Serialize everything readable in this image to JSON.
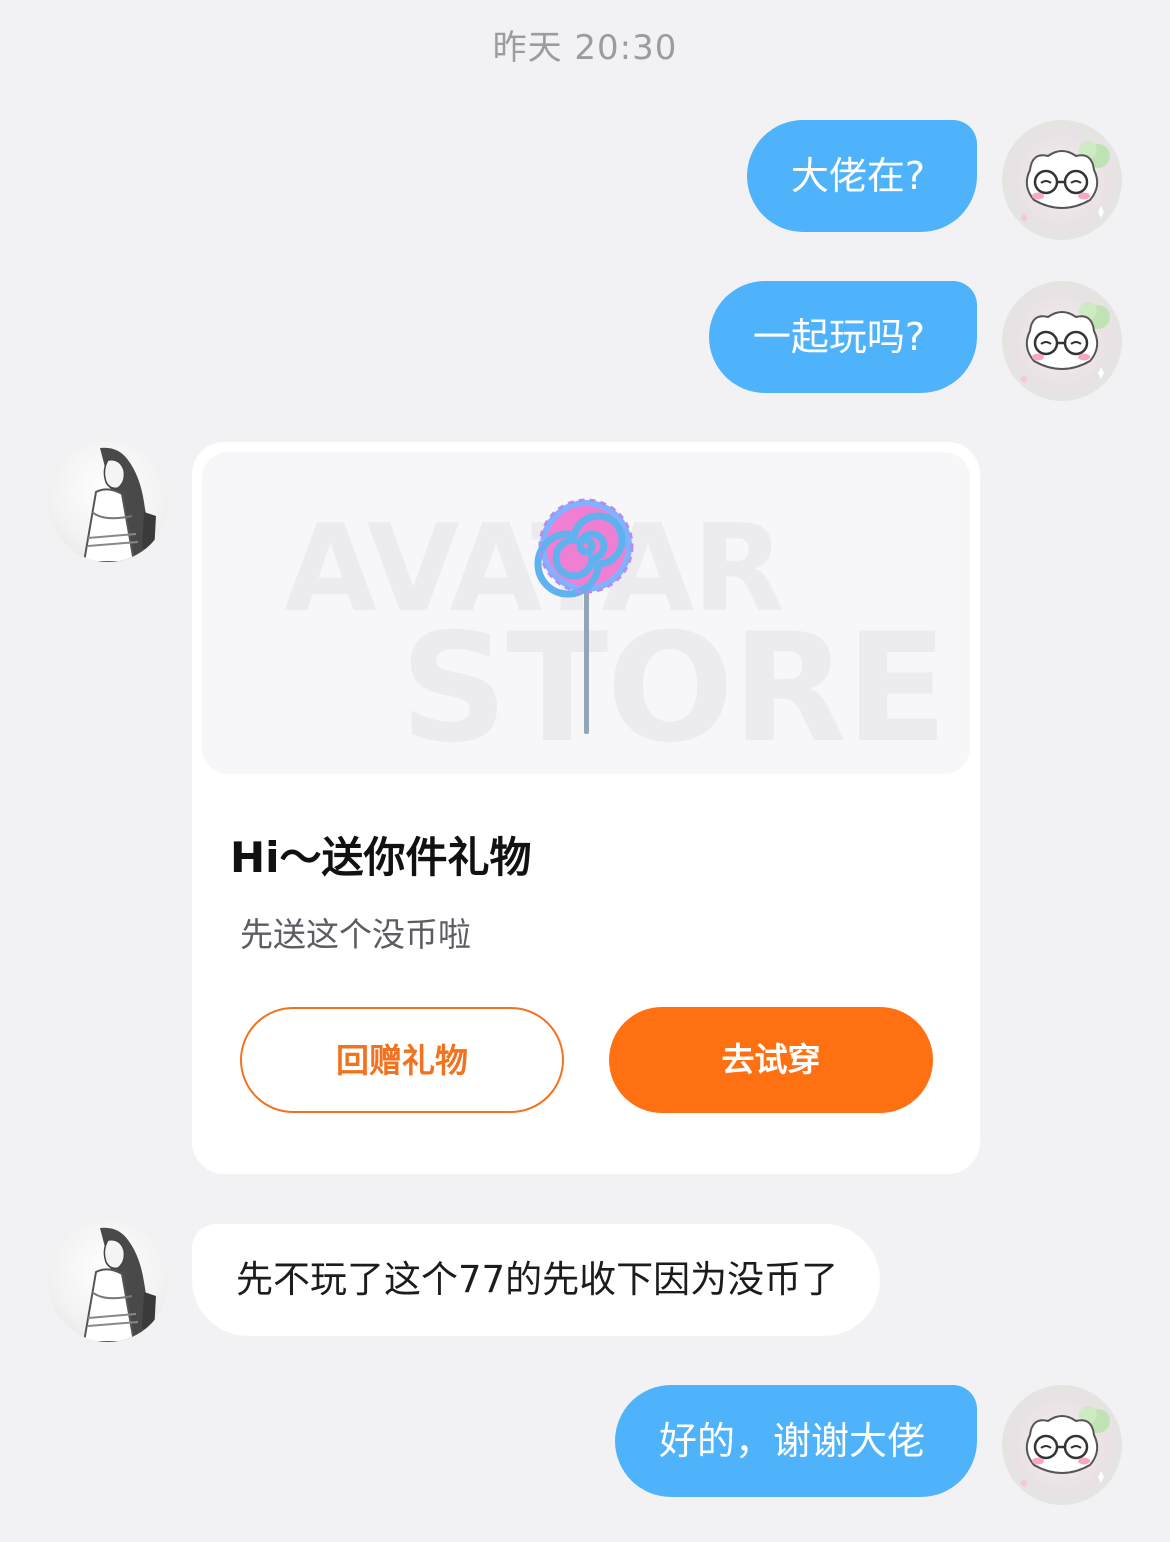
{
  "chat": {
    "timestamp": "昨天 20:30",
    "messages": [
      {
        "side": "right",
        "text": "大佬在?"
      },
      {
        "side": "right",
        "text": "一起玩吗?"
      },
      {
        "side": "left",
        "text": "先不玩了这个77的先收下因为没币了"
      },
      {
        "side": "right",
        "text": "好的，谢谢大佬"
      }
    ]
  },
  "gift_card": {
    "watermark_line1": "AVATAR",
    "watermark_line2": "STORE",
    "item_icon": "lollipop-icon",
    "title": "Hi～送你件礼物",
    "subtitle": "先送这个没币啦",
    "return_gift_label": "回赠礼物",
    "try_on_label": "去试穿"
  },
  "colors": {
    "my_bubble": "#4fb3fb",
    "accent_orange": "#fe7012",
    "background": "#f2f2f4"
  }
}
